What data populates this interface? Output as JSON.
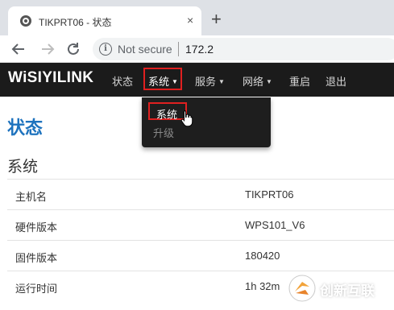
{
  "browser": {
    "tab_title": "TIKPRT06 - 状态",
    "tab_close": "×",
    "new_tab": "+",
    "not_secure": "Not secure",
    "url": "172.2"
  },
  "navbar": {
    "logo": "WiSIYILINK",
    "items": [
      {
        "label": "状态"
      },
      {
        "label": "系统",
        "active": true
      },
      {
        "label": "服务"
      },
      {
        "label": "网络"
      },
      {
        "label": "重启"
      },
      {
        "label": "退出"
      }
    ]
  },
  "dropdown": {
    "items": [
      {
        "label": "系统",
        "highlighted": true
      },
      {
        "label": "升级"
      }
    ]
  },
  "page": {
    "heading": "状态",
    "section_title": "系统",
    "rows": [
      {
        "label": "主机名",
        "value": "TIKPRT06"
      },
      {
        "label": "硬件版本",
        "value": "WPS101_V6"
      },
      {
        "label": "固件版本",
        "value": "180420"
      },
      {
        "label": "运行时间",
        "value": "1h 32m"
      }
    ]
  },
  "watermark": {
    "text": "创新互联"
  },
  "colors": {
    "heading": "#1e73be",
    "navbar_bg": "#1b1b1b",
    "highlight_border": "#e02020"
  }
}
